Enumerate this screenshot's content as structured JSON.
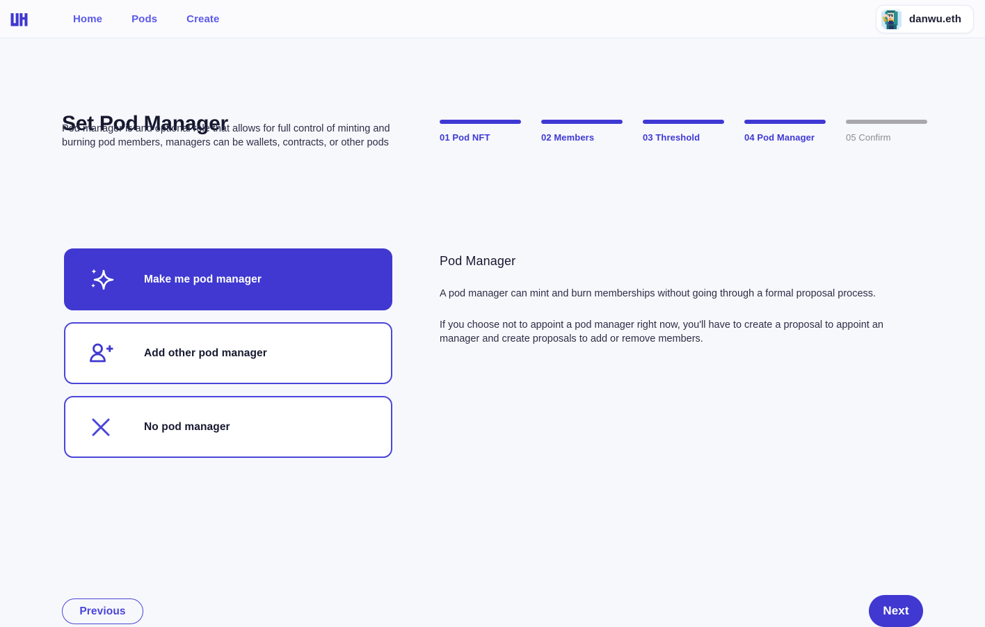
{
  "header": {
    "logo_icon": "modulor-logo-icon",
    "nav": [
      {
        "label": "Home"
      },
      {
        "label": "Pods"
      },
      {
        "label": "Create"
      }
    ],
    "account": {
      "name": "danwu.eth",
      "avatar_icon": "elf-pixel-avatar"
    }
  },
  "page": {
    "title": "Set Pod Manager",
    "intro": "Pod manager is and optional role that allows for full control of minting and burning pod members, managers can be wallets, contracts, or other pods"
  },
  "steps": [
    {
      "label": "01 Pod NFT",
      "state": "active"
    },
    {
      "label": "02 Members",
      "state": "active"
    },
    {
      "label": "03 Threshold",
      "state": "active"
    },
    {
      "label": "04 Pod Manager",
      "state": "active"
    },
    {
      "label": "05 Confirm",
      "state": "inactive"
    }
  ],
  "options": [
    {
      "label": "Make me pod manager",
      "icon": "sparkle-star-icon",
      "selected": true
    },
    {
      "label": "Add other pod manager",
      "icon": "person-add-icon",
      "selected": false
    },
    {
      "label": "No pod manager",
      "icon": "close-x-icon",
      "selected": false
    }
  ],
  "info": {
    "title": "Pod Manager",
    "paragraph1": "A pod manager can mint and burn memberships without going through a formal proposal process.",
    "paragraph2": "If you choose not to appoint a pod manager right now, you'll have to create a proposal to appoint an manager and create proposals to add or remove members."
  },
  "footer": {
    "previous_label": "Previous",
    "next_label": "Next"
  },
  "colors": {
    "primary": "#4038d0",
    "primary_border": "#4b45d8",
    "nav_link": "#5b59e8",
    "step_inactive": "#a9a9ad",
    "background": "#f7f8fc",
    "header_background": "#fbfbfe"
  }
}
